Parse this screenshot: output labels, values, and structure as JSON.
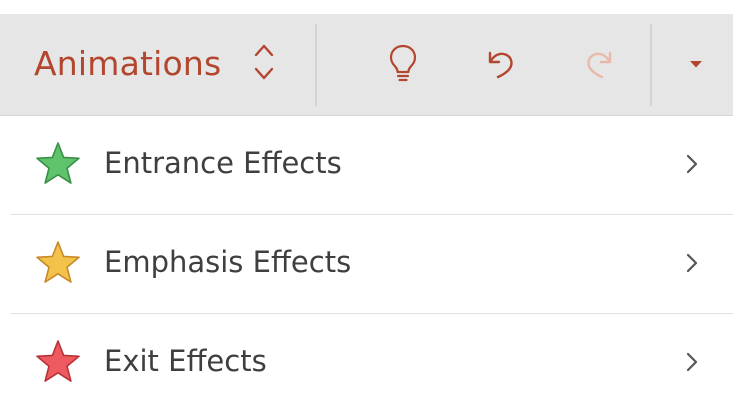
{
  "toolbar": {
    "tab_title": "Animations",
    "icons": {
      "switcher": "chevron-up-down-icon",
      "tell_me": "lightbulb-icon",
      "undo": "undo-icon",
      "redo": "redo-icon",
      "more": "caret-down-icon"
    }
  },
  "menu": {
    "items": [
      {
        "label": "Entrance Effects",
        "icon": "green-star-icon",
        "color": "#5ec36b"
      },
      {
        "label": "Emphasis Effects",
        "icon": "yellow-star-icon",
        "color": "#f3c24a"
      },
      {
        "label": "Exit Effects",
        "icon": "red-star-icon",
        "color": "#ee5a5f"
      }
    ]
  },
  "colors": {
    "accent": "#b2462e",
    "toolbar_bg": "#e6e6e6",
    "redo_disabled": "#e8b9aa"
  }
}
